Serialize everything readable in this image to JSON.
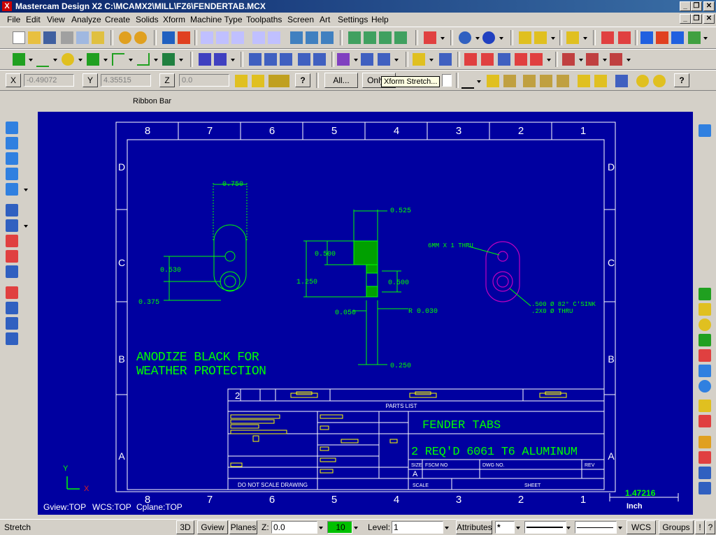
{
  "window": {
    "title": "Mastercam Design X2  C:\\MCAMX2\\MILL\\FZ6\\FENDERTAB.MCX",
    "logo": "X",
    "minimize": "_",
    "restore": "❐",
    "close": "✕"
  },
  "menu": {
    "items": [
      "File",
      "Edit",
      "View",
      "Analyze",
      "Create",
      "Solids",
      "Xform",
      "Machine Type",
      "Toolpaths",
      "Screen",
      "Art",
      "Settings",
      "Help"
    ],
    "min": "_",
    "restore": "❐",
    "close": "✕"
  },
  "autocursor": {
    "x_label": "X",
    "x_value": "-0.49072",
    "y_label": "Y",
    "y_value": "4.35515",
    "z_label": "Z",
    "z_value": "0.0",
    "help_icon": "?",
    "all_button": "All...",
    "only_button": "Only..."
  },
  "tooltip": "Xform Stretch...",
  "ribbon_bar_label": "Ribbon Bar",
  "colors": {
    "viewport": "#0000a0",
    "geometry": "#00ff00",
    "selected": "#c000c0",
    "border": "#ffffff",
    "dimension": "#ffff00",
    "accent_blue": "#0a246a"
  },
  "drawing": {
    "zone_cols": [
      "8",
      "7",
      "6",
      "5",
      "4",
      "3",
      "2",
      "1"
    ],
    "zone_rows": [
      "D",
      "C",
      "B",
      "A"
    ],
    "dims": {
      "d0750": "0.750",
      "d0525": "0.525",
      "d0500a": "0.500",
      "d0530": "0.530",
      "d1250": "1.250",
      "d0500b": "0.500",
      "d0375": "0.375",
      "d0050": "0.050",
      "r0030": "R 0.030",
      "d0250": "0.250",
      "hole_note": "6MM X 1 THRU",
      "csink1": ".500 Ø 82° C'SINK",
      "csink2": ".2X0 Ø THRU"
    },
    "notes": [
      "ANODIZE BLACK FOR",
      "WEATHER PROTECTION"
    ],
    "title_block": {
      "parts_list": "PARTS LIST",
      "title": "FENDER TABS",
      "material": "2 REQ'D 6061 T6 ALUMINUM",
      "size_label": "SIZE",
      "size_value": "A",
      "fscm_label": "FSCM NO",
      "dwg_label": "DWG NO.",
      "rev_label": "REV",
      "do_not_scale": "DO NOT SCALE DRAWING",
      "scale_label": "SCALE",
      "sheet_label": "SHEET",
      "rev_num": "2"
    },
    "scale_value": "1.47216",
    "scale_unit": "Inch",
    "axis_y": "Y",
    "axis_x": "X"
  },
  "views": {
    "gview": "Gview:TOP",
    "wcs": "WCS:TOP",
    "cplane": "Cplane:TOP"
  },
  "status": {
    "mode": "Stretch",
    "btn_3d": "3D",
    "gview": "Gview",
    "planes": "Planes",
    "z_label": "Z:",
    "z_value": "0.0",
    "color_value": "10",
    "level_label": "Level:",
    "level_value": "1",
    "attributes": "Attributes",
    "point_style": "*",
    "wcs": "WCS",
    "groups": "Groups",
    "bang": "!",
    "q": "?"
  }
}
